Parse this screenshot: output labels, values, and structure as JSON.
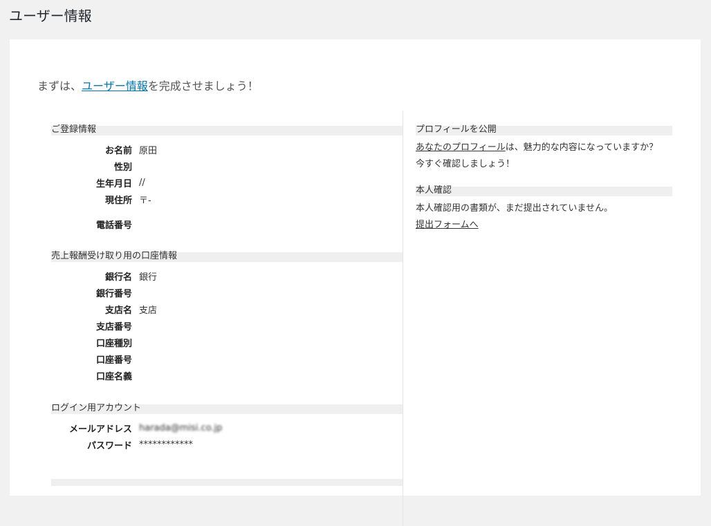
{
  "page": {
    "title": "ユーザー情報"
  },
  "intro": {
    "prefix": "まずは、",
    "link": "ユーザー情報",
    "suffix": "を完成させましょう！"
  },
  "registration": {
    "heading": "ご登録情報",
    "rows": [
      {
        "label": "お名前",
        "value": "原田"
      },
      {
        "label": "性別",
        "value": ""
      },
      {
        "label": "生年月日",
        "value": "//"
      },
      {
        "label": "現住所",
        "value": "〒-"
      },
      {
        "label": "電話番号",
        "value": ""
      }
    ]
  },
  "bank": {
    "heading": "売上報酬受け取り用の口座情報",
    "rows": [
      {
        "label": "銀行名",
        "value": "銀行"
      },
      {
        "label": "銀行番号",
        "value": ""
      },
      {
        "label": "支店名",
        "value": "支店"
      },
      {
        "label": "支店番号",
        "value": ""
      },
      {
        "label": "口座種別",
        "value": ""
      },
      {
        "label": "口座番号",
        "value": ""
      },
      {
        "label": "口座名義",
        "value": ""
      }
    ]
  },
  "login": {
    "heading": "ログイン用アカウント",
    "rows": [
      {
        "label": "メールアドレス",
        "value": "harada@misi.co.jp"
      },
      {
        "label": "パスワード",
        "value": "************"
      }
    ]
  },
  "profile": {
    "heading": "プロフィールを公開",
    "link": "あなたのプロフィール",
    "text": "は、魅力的な内容になっていますか？　今すぐ確認しましょう！"
  },
  "identity": {
    "heading": "本人確認",
    "text": "本人確認用の書類が、まだ提出されていません。",
    "link": "提出フォームへ"
  }
}
